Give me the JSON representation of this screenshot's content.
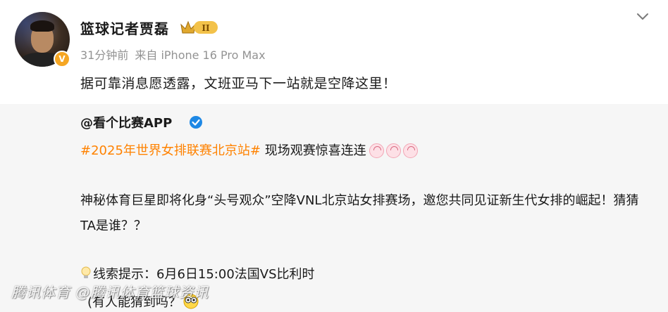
{
  "post": {
    "author": "篮球记者贾磊",
    "crown_level": "II",
    "vip_badge": "V",
    "time": "31分钟前",
    "source": "来自 iPhone 16 Pro Max",
    "text": "据可靠消息愿透露，文班亚马下一站就是空降这里！"
  },
  "repost": {
    "user": "@看个比赛APP",
    "hashtag": "#2025年世界女排联赛北京站#",
    "line1_rest": " 现场观赛惊喜连连",
    "paragraph": "神秘体育巨星即将化身“头号观众”空降VNL北京站女排赛场，邀您共同见证新生代女排的崛起！猜猜TA是谁？？",
    "hint": "线索提示：6月6日15:00法国VS比利时",
    "guess": "(有人能猜到吗？"
  },
  "watermark": "腾讯体育 @腾讯体育篮球资讯",
  "colors": {
    "hashtag": "#ff8200",
    "verified": "#1e88e5",
    "vip": "#f5a623",
    "repost_bg": "#f6f6f6"
  },
  "icons": [
    "chevron-down-icon",
    "crown-badge-icon",
    "verified-icon",
    "lightbulb-icon",
    "party-emoji-icon",
    "eyes-emoji-icon"
  ]
}
